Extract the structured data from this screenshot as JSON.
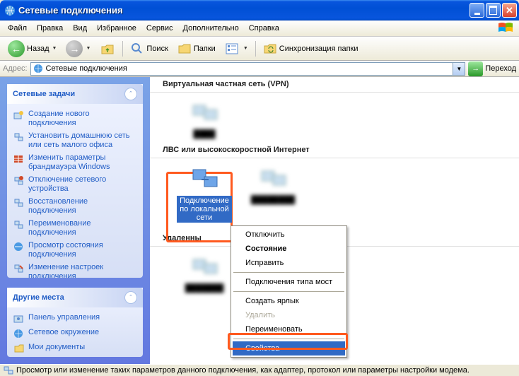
{
  "titlebar": {
    "title": "Сетевые подключения"
  },
  "menubar": {
    "items": [
      "Файл",
      "Правка",
      "Вид",
      "Избранное",
      "Сервис",
      "Дополнительно",
      "Справка"
    ]
  },
  "toolbar": {
    "back": "Назад",
    "search": "Поиск",
    "folders": "Папки",
    "sync": "Синхронизация папки"
  },
  "addressbar": {
    "label": "Адрес:",
    "value": "Сетевые подключения",
    "go": "Переход"
  },
  "sidebar": {
    "panel_tasks": {
      "title": "Сетевые задачи",
      "items": [
        "Создание нового подключения",
        "Установить домашнюю сеть или сеть малого офиса",
        "Изменить параметры брандмауэра Windows",
        "Отключение сетевого устройства",
        "Восстановление подключения",
        "Переименование подключения",
        "Просмотр состояния подключения",
        "Изменение настроек подключения"
      ]
    },
    "panel_other": {
      "title": "Другие места",
      "items": [
        "Панель управления",
        "Сетевое окружение",
        "Мои документы"
      ]
    }
  },
  "main": {
    "section_vpn": "Виртуальная частная сеть (VPN)",
    "section_lan": "ЛВС или высокоскоростной Интернет",
    "section_remote": "Удаленны",
    "lan_conn_name": "Подключение по локальной сети"
  },
  "ctx_menu": {
    "items": [
      {
        "label": "Отключить",
        "disabled": false
      },
      {
        "label": "Состояние",
        "disabled": false,
        "bold": true
      },
      {
        "label": "Исправить",
        "disabled": false
      },
      {
        "sep": true
      },
      {
        "label": "Подключения типа мост",
        "disabled": false
      },
      {
        "sep": true
      },
      {
        "label": "Создать ярлык",
        "disabled": false
      },
      {
        "label": "Удалить",
        "disabled": true
      },
      {
        "label": "Переименовать",
        "disabled": false
      },
      {
        "sep": true
      },
      {
        "label": "Свойства",
        "disabled": false,
        "hovered": true
      }
    ]
  },
  "status": "Просмотр или изменение таких параметров данного подключения, как адаптер, протокол или параметры настройки модема."
}
